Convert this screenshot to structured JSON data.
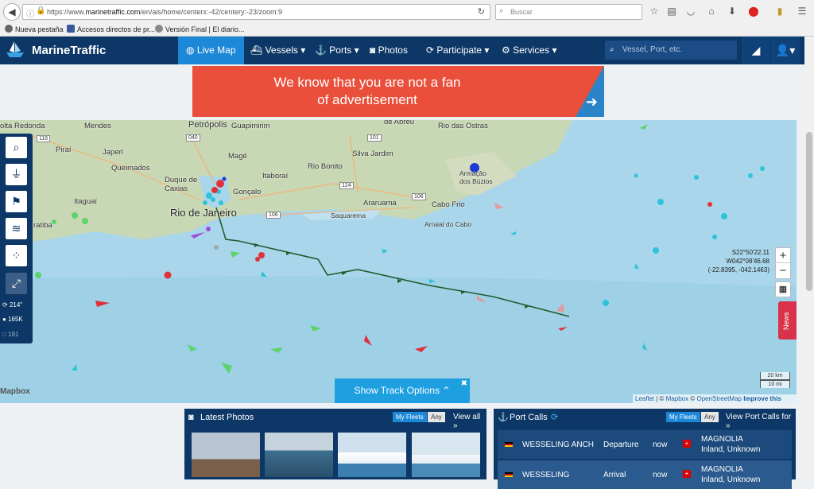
{
  "browser": {
    "url_prefix": "https://www.",
    "url_domain": "marinetraffic.com",
    "url_path": "/en/ais/home/centerx:-42/centery:-23/zoom:9",
    "search_placeholder": "Buscar",
    "bookmarks": [
      "Nueva pestaña",
      "Accesos directos de pr...",
      "Versión Final | El diario..."
    ]
  },
  "nav": {
    "brand": "MarineTraffic",
    "items": [
      "Live Map",
      "Vessels",
      "Ports",
      "Photos",
      "Participate",
      "Services"
    ],
    "search_placeholder": "Vessel, Port, etc."
  },
  "ad": {
    "line1": "We know that you are not a fan",
    "line2": "of advertisement"
  },
  "map": {
    "cities": [
      "olta Redonda",
      "Mendes",
      "Petrópolis",
      "Guapimirim",
      "de Abreu",
      "Rio das Ostras",
      "Japeri",
      "Magé",
      "Silva Jardim",
      "Armação dos Búzios",
      "Queimados",
      "Duque de Caxias",
      "Itaboraí",
      "Rio Bonito",
      "Itaguaí",
      "Gonçalo",
      "Araruama",
      "Cabo Frio",
      "Rio de Janeiro",
      "Saquarema",
      "Arraial do Cabo",
      "Piraí",
      "ratiba"
    ],
    "roads": [
      "116",
      "040",
      "101",
      "124",
      "106",
      "106"
    ],
    "coords_line1": "S22°50'22.11",
    "coords_line2": "W042°08'46.68",
    "coords_line3": "(-22.8395, -042.1463)",
    "stats": [
      "214\"",
      "165K",
      "191"
    ],
    "news_label": "News",
    "track_label": "Show Track Options",
    "scale_km": "20 km",
    "scale_mi": "10 mi",
    "mapbox_label": "Mapbox",
    "attribution": [
      "Leaflet",
      "Mapbox",
      "OpenStreetMap",
      "Improve this map"
    ]
  },
  "photos": {
    "title": "Latest Photos",
    "my_fleets": "My Fleets",
    "any": "Any",
    "view_all": "View all »"
  },
  "port_calls": {
    "title": "Port Calls",
    "my_fleets": "My Fleets",
    "any": "Any",
    "view_all": "View Port Calls for »",
    "rows": [
      {
        "vessel": "WESSELING ANCH",
        "event": "Departure",
        "time": "now",
        "port1": "MAGNOLIA",
        "port2": "Inland, Unknown"
      },
      {
        "vessel": "WESSELING",
        "event": "Arrival",
        "time": "now",
        "port1": "MAGNOLIA",
        "port2": "Inland, Unknown"
      }
    ]
  },
  "colors": {
    "nav_bg": "#0c3766",
    "accent": "#1e88d8",
    "ad_bg": "#e94f3a",
    "sea": "#a9d6ea",
    "track": "#1f5c2e"
  }
}
